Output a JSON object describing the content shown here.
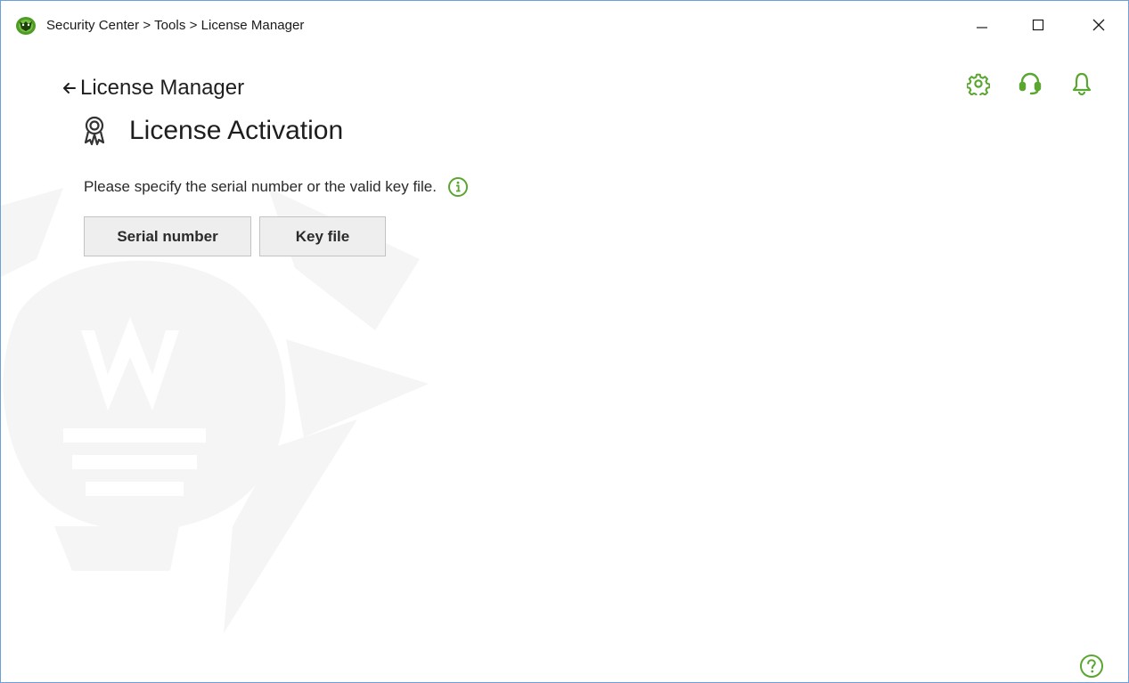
{
  "window": {
    "breadcrumb": "Security Center > Tools > License Manager",
    "controls": {
      "minimize": "minimize",
      "maximize": "maximize",
      "close": "close"
    }
  },
  "toolbar": {
    "icons": [
      "gear-icon",
      "headset-icon",
      "bell-icon"
    ]
  },
  "header": {
    "back_label": "License Manager",
    "title": "License Activation"
  },
  "main": {
    "description": "Please specify the serial number or the valid key file.",
    "buttons": {
      "serial_number": "Serial number",
      "key_file": "Key file"
    }
  },
  "colors": {
    "accent": "#5aa630",
    "window_border": "#6f9fd8",
    "button_bg": "#eeeeee",
    "watermark": "#f5f5f5"
  }
}
